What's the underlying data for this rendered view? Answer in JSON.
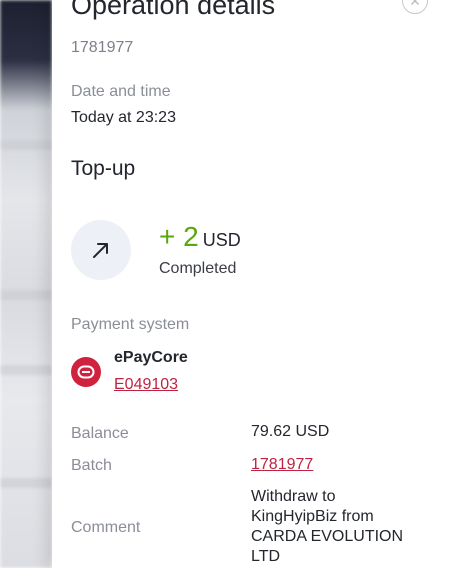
{
  "panel": {
    "title": "Operation details",
    "operation_id": "1781977",
    "date_label": "Date and time",
    "date_value": "Today at 23:23",
    "type": "Top-up",
    "amount": "+ 2",
    "currency": "USD",
    "status": "Completed",
    "payment_system_label": "Payment system",
    "payment_system_name": "ePayCore",
    "payment_account": "E049103",
    "balance_label": "Balance",
    "balance_value": "79.62 USD",
    "batch_label": "Batch",
    "batch_value": "1781977",
    "comment_label": "Comment",
    "comment_value": "Withdraw to KingHyipBiz from CARDA EVOLUTION LTD"
  },
  "icons": {
    "close": "close-icon",
    "direction": "arrow-up-right-icon",
    "payment_logo": "epaycore-logo-icon"
  },
  "colors": {
    "amount": "#5aa60f",
    "link": "#c02342",
    "logo": "#d0223f"
  }
}
